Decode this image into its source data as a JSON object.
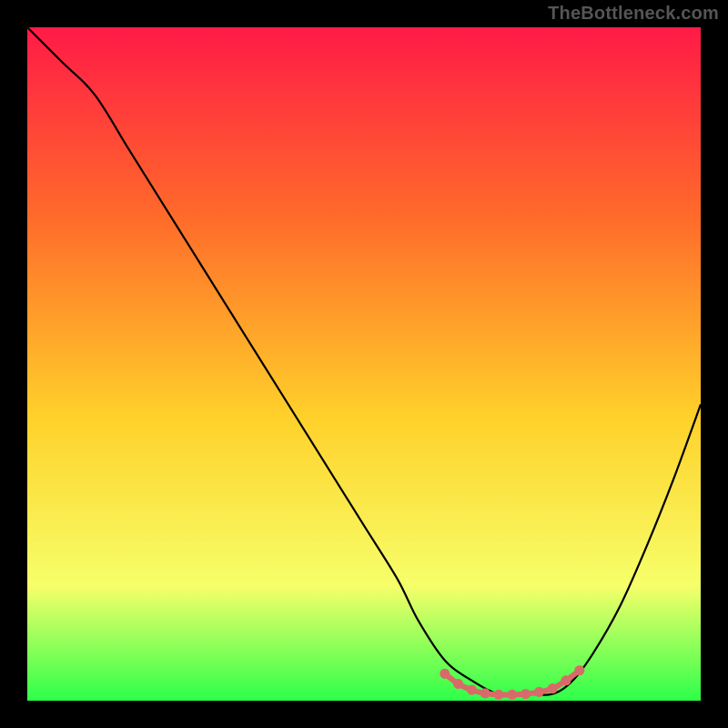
{
  "watermark": "TheBottleneck.com",
  "colors": {
    "background": "#000000",
    "gradient_top": "#ff1a47",
    "gradient_mid_upper": "#ff6a2a",
    "gradient_mid": "#ffd12a",
    "gradient_mid_lower": "#f6ff6a",
    "gradient_bottom": "#2dff4a",
    "curve": "#000000",
    "marker": "#d86a6a"
  },
  "chart_data": {
    "type": "line",
    "title": "",
    "xlabel": "",
    "ylabel": "",
    "xlim": [
      0,
      100
    ],
    "ylim": [
      0,
      100
    ],
    "series": [
      {
        "name": "bottleneck-curve",
        "x": [
          0,
          5,
          10,
          15,
          20,
          25,
          30,
          35,
          40,
          45,
          50,
          55,
          58,
          62,
          66,
          70,
          74,
          78,
          81,
          84,
          88,
          92,
          96,
          100
        ],
        "y": [
          100,
          95,
          90,
          82,
          74,
          66,
          58,
          50,
          42,
          34,
          26,
          18,
          12,
          6,
          3,
          1,
          1,
          1,
          3,
          7,
          14,
          23,
          33,
          44
        ]
      }
    ],
    "markers": {
      "name": "optimal-range",
      "x": [
        62,
        64,
        66,
        68,
        70,
        72,
        74,
        76,
        78,
        80,
        82
      ],
      "y": [
        4,
        2.5,
        1.6,
        1.1,
        0.9,
        0.9,
        1.0,
        1.3,
        1.8,
        3.0,
        4.5
      ]
    }
  }
}
